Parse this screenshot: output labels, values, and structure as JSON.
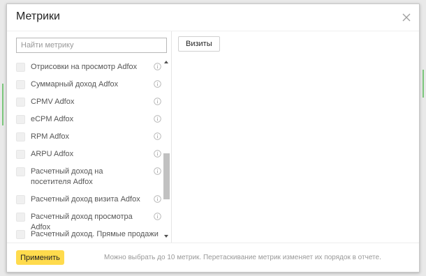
{
  "dialog": {
    "title": "Метрики"
  },
  "search": {
    "placeholder": "Найти метрику",
    "value": ""
  },
  "metrics_list": [
    {
      "label": "Отрисовки на просмотр Adfox",
      "checked": false
    },
    {
      "label": "Суммарный доход Adfox",
      "checked": false
    },
    {
      "label": "CPMV Adfox",
      "checked": false
    },
    {
      "label": "eCPM Adfox",
      "checked": false
    },
    {
      "label": "RPM Adfox",
      "checked": false
    },
    {
      "label": "ARPU Adfox",
      "checked": false
    },
    {
      "label": "Расчетный доход на посетителя Adfox",
      "checked": false
    },
    {
      "label": "Расчетный доход визита Adfox",
      "checked": false
    },
    {
      "label": "Расчетный доход просмотра Adfox",
      "checked": false
    },
    {
      "label": "Расчетный доход. Прямые продажи",
      "checked": false
    }
  ],
  "selected_metrics": [
    {
      "label": "Визиты"
    }
  ],
  "footer": {
    "apply_label": "Применить",
    "hint": "Можно выбрать до 10 метрик. Перетаскивание метрик изменяет их порядок в отчете."
  },
  "colors": {
    "accent_button": "#ffdb4d",
    "checkbox_bg": "#f0f0f0",
    "hint_text": "#999999"
  },
  "icons": {
    "close": "close-icon",
    "info": "info-icon"
  }
}
